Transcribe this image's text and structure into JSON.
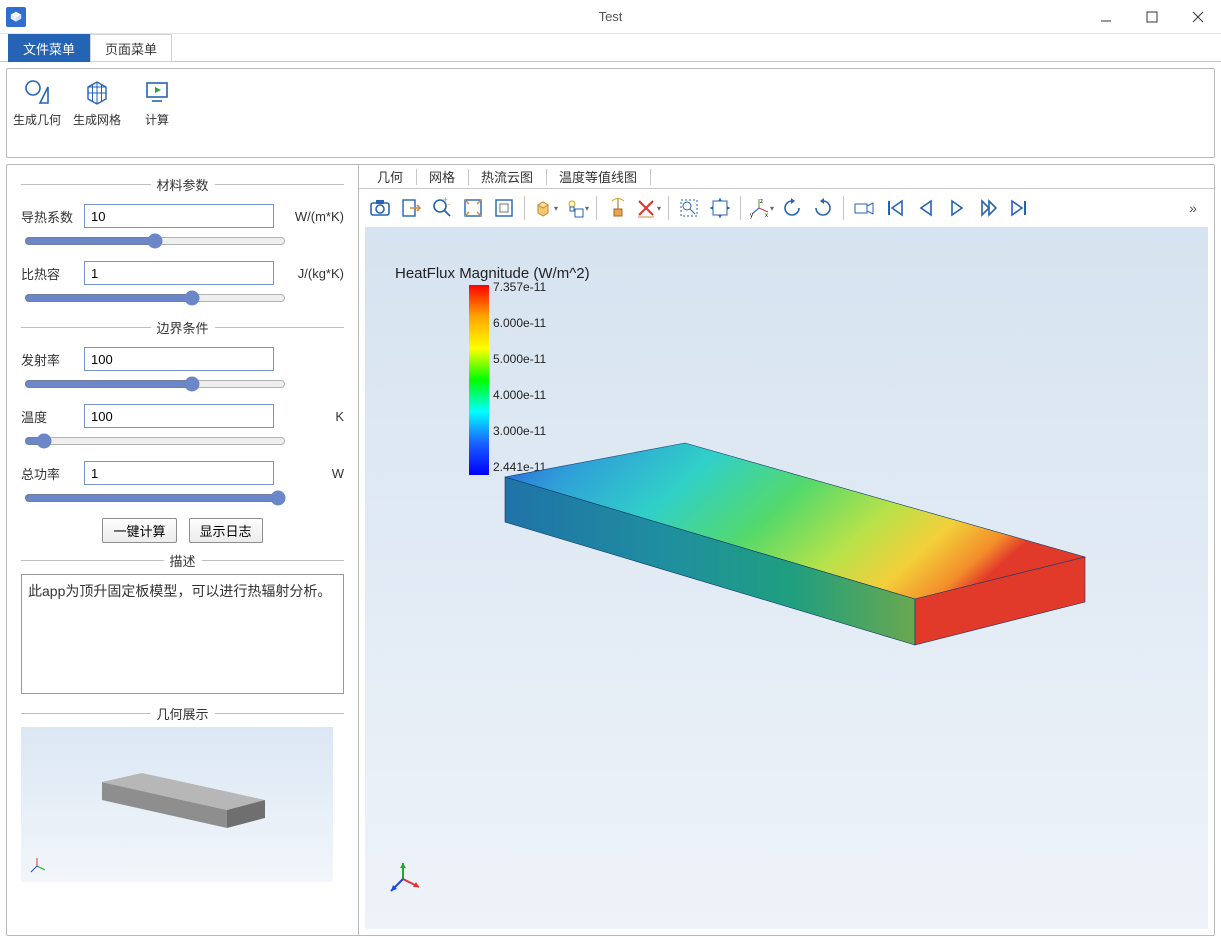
{
  "window": {
    "title": "Test"
  },
  "tabs": [
    {
      "label": "文件菜单",
      "active": true
    },
    {
      "label": "页面菜单",
      "active": false
    }
  ],
  "ribbon": [
    {
      "label": "生成几何",
      "icon": "geom"
    },
    {
      "label": "生成网格",
      "icon": "mesh"
    },
    {
      "label": "计算",
      "icon": "run"
    }
  ],
  "panels": {
    "material_title": "材料参数",
    "bc_title": "边界条件",
    "desc_title": "描述",
    "geom_title": "几何展示"
  },
  "params": {
    "k_label": "导热系数",
    "k_value": "10",
    "k_unit": "W/(m*K)",
    "cp_label": "比热容",
    "cp_value": "1",
    "cp_unit": "J/(kg*K)",
    "emiss_label": "发射率",
    "emiss_value": "100",
    "temp_label": "温度",
    "temp_value": "100",
    "temp_unit": "K",
    "power_label": "总功率",
    "power_value": "1",
    "power_unit": "W"
  },
  "buttons": {
    "compute": "一键计算",
    "log": "显示日志"
  },
  "description": "此app为顶升固定板模型，可以进行热辐射分析。",
  "viewTabs": [
    "几何",
    "网格",
    "热流云图",
    "温度等值线图"
  ],
  "colorbar": {
    "title": "HeatFlux Magnitude (W/m^2)",
    "ticks": [
      "7.357e-11",
      "6.000e-11",
      "5.000e-11",
      "4.000e-11",
      "3.000e-11",
      "2.441e-11"
    ]
  }
}
